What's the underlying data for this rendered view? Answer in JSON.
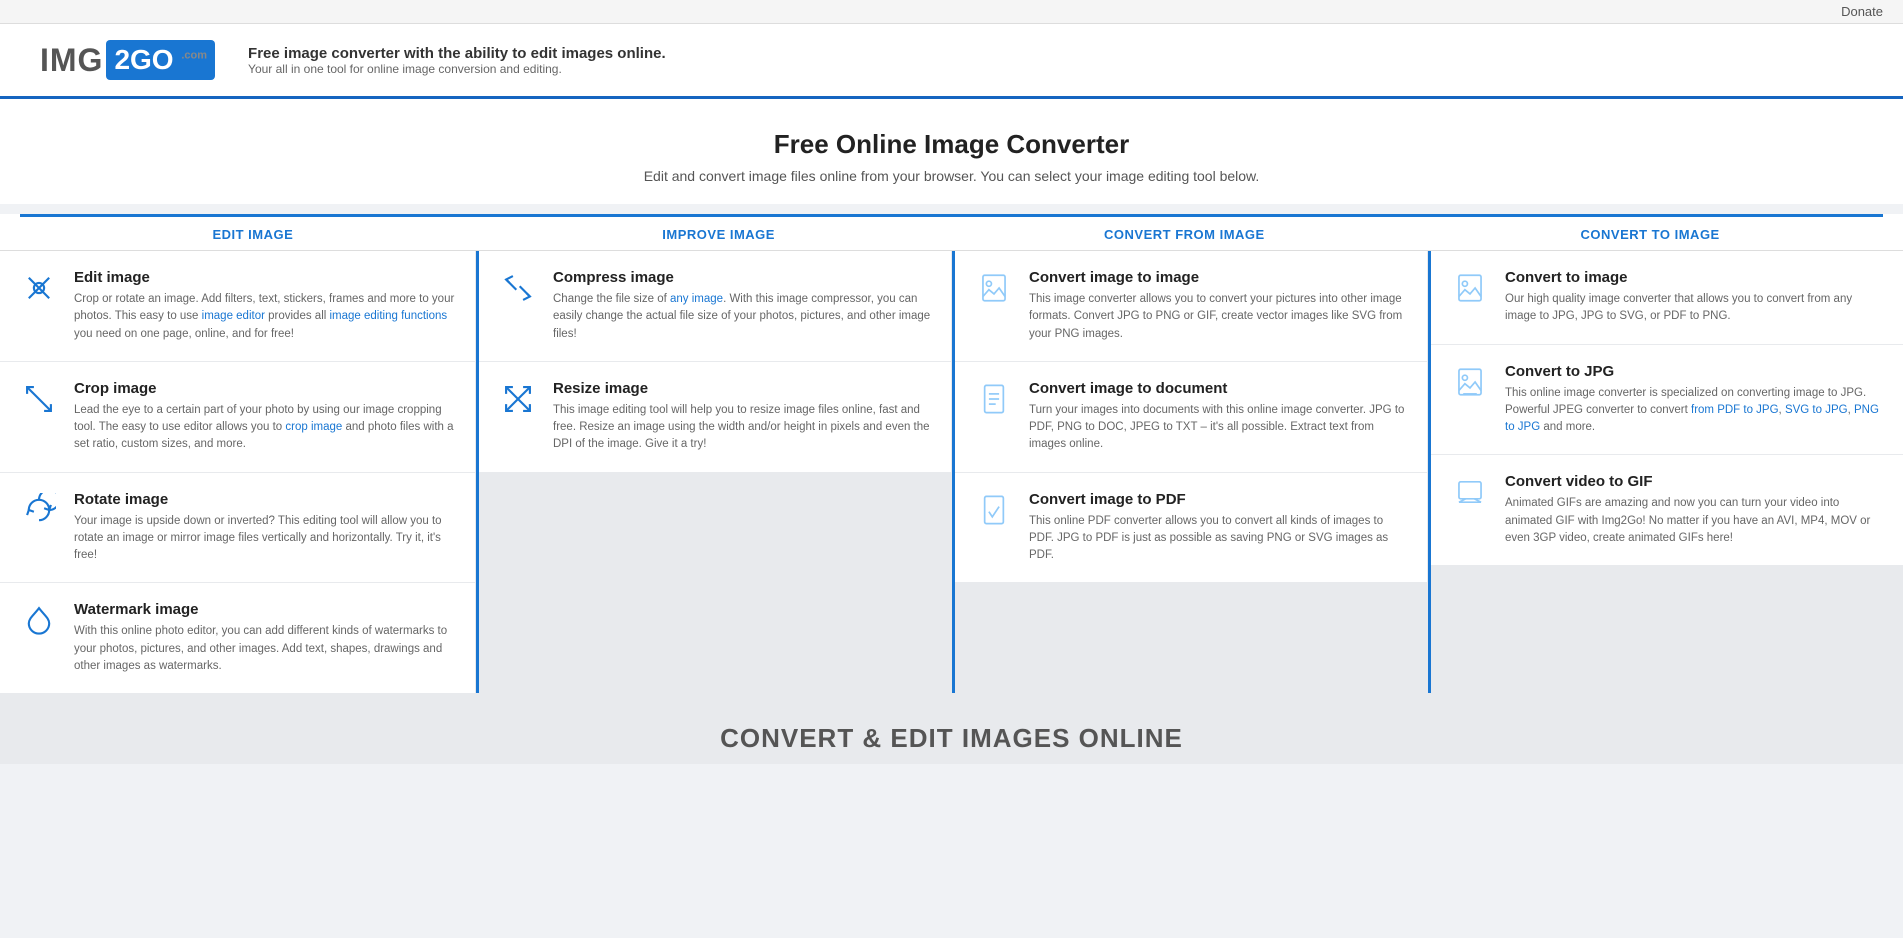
{
  "topbar": {
    "donate_label": "Donate"
  },
  "header": {
    "logo_img": "IMG",
    "logo_2": "2",
    "logo_go": "GO",
    "logo_com": ".com",
    "tagline_main": "Free image converter with the ability to edit images online.",
    "tagline_sub": "Your all in one tool for online image conversion and editing."
  },
  "hero": {
    "title": "Free Online Image Converter",
    "subtitle": "Edit and convert image files online from your browser. You can select your image editing tool below."
  },
  "columns": [
    {
      "header": "EDIT IMAGE",
      "tools": [
        {
          "title": "Edit image",
          "description": "Crop or rotate an image. Add filters, text, stickers, frames and more to your photos. This easy to use image editor provides all image editing functions you need on one page, online, and for free!",
          "icon": "edit"
        },
        {
          "title": "Crop image",
          "description": "Lead the eye to a certain part of your photo by using our image cropping tool. The easy to use editor allows you to crop image and photo files with a set ratio, custom sizes, and more.",
          "icon": "crop"
        },
        {
          "title": "Rotate image",
          "description": "Your image is upside down or inverted? This editing tool will allow you to rotate an image or mirror image files vertically and horizontally. Try it, it's free!",
          "icon": "rotate"
        },
        {
          "title": "Watermark image",
          "description": "With this online photo editor, you can add different kinds of watermarks to your photos, pictures, and other images. Add text, shapes, drawings and other images as watermarks.",
          "icon": "watermark"
        }
      ]
    },
    {
      "header": "IMPROVE IMAGE",
      "tools": [
        {
          "title": "Compress image",
          "description": "Change the file size of any image. With this image compressor, you can easily change the actual file size of your photos, pictures, and other image files!",
          "icon": "compress"
        },
        {
          "title": "Resize image",
          "description": "This image editing tool will help you to resize image files online, fast and free. Resize an image using the width and/or height in pixels and even the DPI of the image. Give it a try!",
          "icon": "resize"
        }
      ]
    },
    {
      "header": "CONVERT FROM IMAGE",
      "tools": [
        {
          "title": "Convert image to image",
          "description": "This image converter allows you to convert your pictures into other image formats. Convert JPG to PNG or GIF, create vector images like SVG from your PNG images.",
          "icon": "convert-image"
        },
        {
          "title": "Convert image to document",
          "description": "Turn your images into documents with this online image converter. JPG to PDF, PNG to DOC, JPEG to TXT – it's all possible. Extract text from images online.",
          "icon": "convert-doc"
        },
        {
          "title": "Convert image to PDF",
          "description": "This online PDF converter allows you to convert all kinds of images to PDF. JPG to PDF is just as possible as saving PNG or SVG images as PDF.",
          "icon": "convert-pdf"
        }
      ]
    },
    {
      "header": "CONVERT TO IMAGE",
      "tools": [
        {
          "title": "Convert to image",
          "description": "Our high quality image converter that allows you to convert from any image to JPG, JPG to SVG, or PDF to PNG.",
          "icon": "to-image"
        },
        {
          "title": "Convert to JPG",
          "description": "This online image converter is specialized on converting image to JPG. Powerful JPEG converter to convert from PDF to JPG, SVG to JPG, PNG to JPG and more.",
          "icon": "to-jpg"
        },
        {
          "title": "Convert video to GIF",
          "description": "Animated GIFs are amazing and now you can turn your video into animated GIF with Img2Go! No matter if you have an AVI, MP4, MOV or even 3GP video, create animated GIFs here!",
          "icon": "to-gif"
        }
      ]
    }
  ],
  "footer": {
    "title": "CONVERT & EDIT IMAGES ONLINE"
  }
}
